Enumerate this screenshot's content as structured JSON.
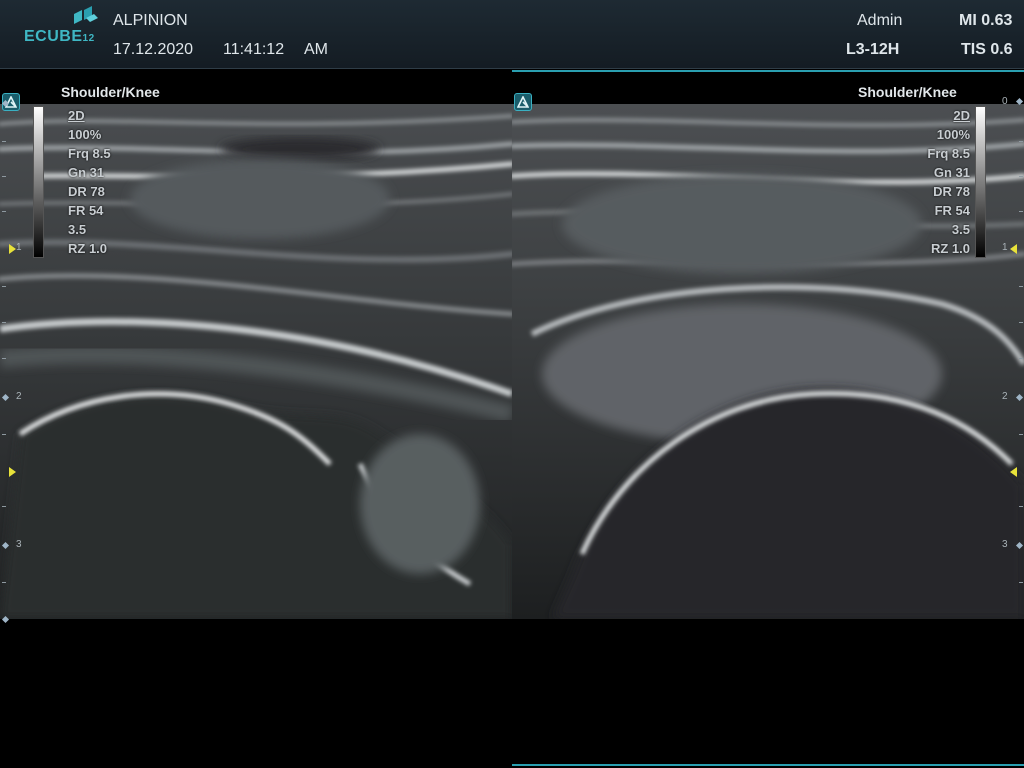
{
  "header": {
    "logo_text": "ECUBE",
    "logo_suffix": "12",
    "brand": "ALPINION",
    "date": "17.12.2020",
    "time": "11:41:12",
    "ampm": "AM",
    "user": "Admin",
    "probe": "L3-12H",
    "mi": "MI 0.63",
    "tis": "TIS 0.6"
  },
  "left_pane": {
    "preset": "Shoulder/Knee",
    "params": [
      "2D",
      "100%",
      "Frq 8.5",
      "Gn 31",
      "DR 78",
      "FR 54",
      "3.5",
      "RZ 1.0"
    ],
    "depth_labels": [
      "1",
      "2",
      "3"
    ]
  },
  "right_pane": {
    "preset": "Shoulder/Knee",
    "params": [
      "2D",
      "100%",
      "Frq 8.5",
      "Gn 31",
      "DR 78",
      "FR 54",
      "3.5",
      "RZ 1.0"
    ],
    "depth_labels": [
      "0",
      "1",
      "2",
      "3"
    ]
  },
  "colors": {
    "accent": "#2a9fb0",
    "focus_marker": "#e8e23a",
    "logo": "#3fb7c4"
  }
}
